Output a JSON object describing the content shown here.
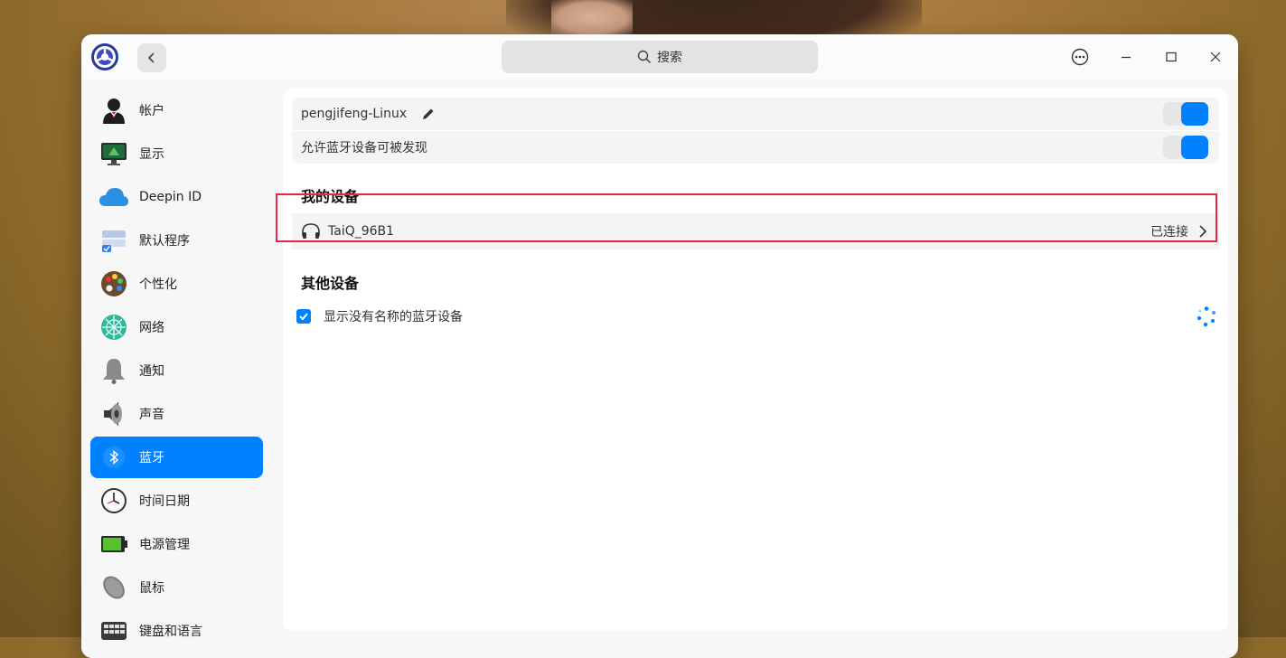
{
  "search": {
    "placeholder": "搜索"
  },
  "sidebar": {
    "items": [
      {
        "label": "帐户",
        "icon": "account-icon"
      },
      {
        "label": "显示",
        "icon": "monitor-icon"
      },
      {
        "label": "Deepin ID",
        "icon": "cloud-icon"
      },
      {
        "label": "默认程序",
        "icon": "default-apps-icon"
      },
      {
        "label": "个性化",
        "icon": "palette-icon"
      },
      {
        "label": "网络",
        "icon": "network-icon"
      },
      {
        "label": "通知",
        "icon": "bell-icon"
      },
      {
        "label": "声音",
        "icon": "speaker-icon"
      },
      {
        "label": "蓝牙",
        "icon": "bluetooth-icon",
        "active": true
      },
      {
        "label": "时间日期",
        "icon": "clock-icon"
      },
      {
        "label": "电源管理",
        "icon": "battery-icon"
      },
      {
        "label": "鼠标",
        "icon": "mouse-icon"
      },
      {
        "label": "键盘和语言",
        "icon": "keyboard-icon"
      }
    ]
  },
  "bluetooth": {
    "device_name": "pengjifeng-Linux",
    "device_name_toggle_on": true,
    "discoverable_label": "允许蓝牙设备可被发现",
    "discoverable_on": true,
    "my_devices_title": "我的设备",
    "my_devices": [
      {
        "name": "TaiQ_96B1",
        "status": "已连接",
        "icon": "headphones-icon"
      }
    ],
    "other_devices_title": "其他设备",
    "show_unnamed_label": "显示没有名称的蓝牙设备",
    "show_unnamed_checked": true
  },
  "colors": {
    "accent": "#0081ff",
    "highlight": "#e8244a"
  }
}
